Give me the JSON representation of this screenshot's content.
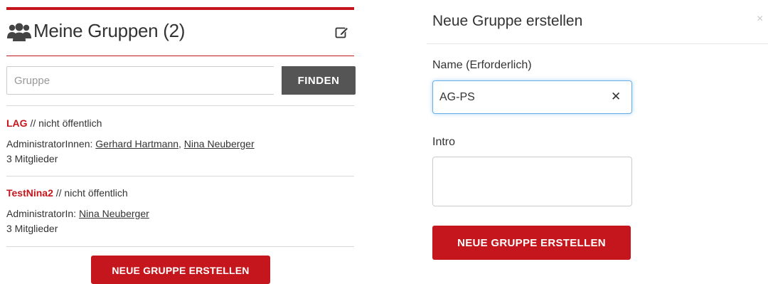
{
  "left_panel": {
    "header": {
      "title": "Meine Gruppen (2)",
      "icon": "users-icon",
      "edit_icon": "edit-icon"
    },
    "search": {
      "placeholder": "Gruppe",
      "value": "",
      "button_label": "FINDEN"
    },
    "groups": [
      {
        "name": "LAG",
        "visibility": "// nicht öffentlich",
        "admins_label": "AdministratorInnen:",
        "admins": [
          "Gerhard Hartmann",
          "Nina Neuberger"
        ],
        "admin_separator": ",",
        "members": "3 Mitglieder"
      },
      {
        "name": "TestNina2",
        "visibility": "// nicht öffentlich",
        "admins_label": "AdministratorIn:",
        "admins": [
          "Nina Neuberger"
        ],
        "members": "3 Mitglieder"
      }
    ],
    "create_button_label": "NEUE GRUPPE ERSTELLEN"
  },
  "dialog": {
    "title": "Neue Gruppe erstellen",
    "close_symbol": "×",
    "name_label": "Name (Erforderlich)",
    "name_value": "AG-PS",
    "clear_symbol": "✕",
    "intro_label": "Intro",
    "intro_value": "",
    "create_button_label": "NEUE GRUPPE ERSTELLEN"
  },
  "colors": {
    "accent_red": "#c4161c",
    "dark_button": "#555555",
    "focus_blue": "#66afe9"
  }
}
